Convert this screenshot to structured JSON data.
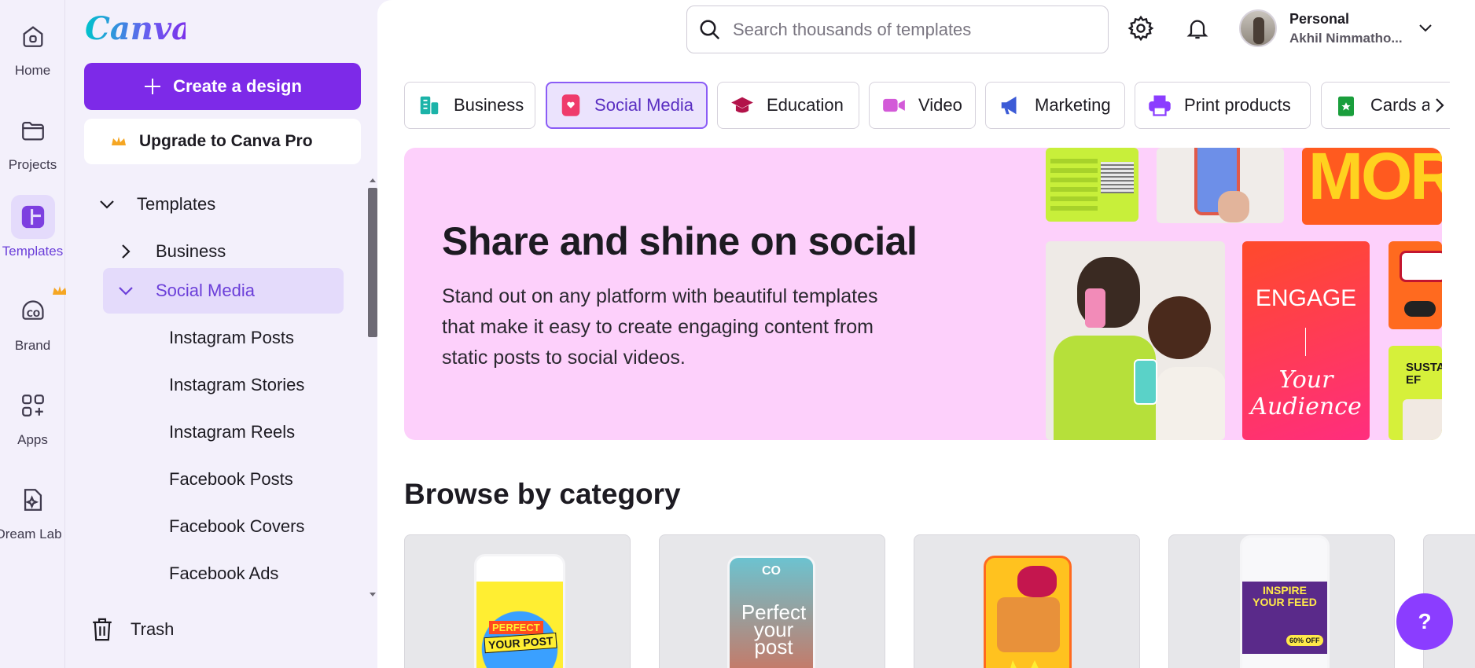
{
  "rail": {
    "items": [
      {
        "label": "Home",
        "icon": "home-icon"
      },
      {
        "label": "Projects",
        "icon": "folder-icon"
      },
      {
        "label": "Templates",
        "icon": "templates-icon"
      },
      {
        "label": "Brand",
        "icon": "brand-icon"
      },
      {
        "label": "Apps",
        "icon": "apps-icon"
      },
      {
        "label": "Dream Lab",
        "icon": "dream-lab-icon"
      }
    ]
  },
  "sidebar": {
    "logo": "Canva",
    "create_label": "Create a design",
    "upgrade_label": "Upgrade to Canva Pro",
    "tree": {
      "templates": "Templates",
      "business": "Business",
      "social_media": "Social Media",
      "children": [
        "Instagram Posts",
        "Instagram Stories",
        "Instagram Reels",
        "Facebook Posts",
        "Facebook Covers",
        "Facebook Ads"
      ]
    },
    "trash_label": "Trash"
  },
  "header": {
    "search_placeholder": "Search thousands of templates",
    "profile_name": "Personal",
    "profile_sub": "Akhil Nimmatho..."
  },
  "categories": [
    {
      "label": "Business",
      "icon": "business-icon",
      "color": "#1bb3a8"
    },
    {
      "label": "Social Media",
      "icon": "social-media-icon",
      "color": "#ef3b6b"
    },
    {
      "label": "Education",
      "icon": "education-icon",
      "color": "#b2134a"
    },
    {
      "label": "Video",
      "icon": "video-icon",
      "color": "#d35ad8"
    },
    {
      "label": "Marketing",
      "icon": "marketing-icon",
      "color": "#3c5bd6"
    },
    {
      "label": "Print products",
      "icon": "print-icon",
      "color": "#8b3dff"
    },
    {
      "label": "Cards an",
      "icon": "cards-icon",
      "color": "#1a9e3c"
    }
  ],
  "hero": {
    "title": "Share and shine on social",
    "text": "Stand out on any platform with beautiful templates that make it easy to create engaging content from static posts to  social videos.",
    "tiles": {
      "more": "MOR",
      "engage": "ENGAGE",
      "your_audience": "Your Audience",
      "susta": "SUSTA EF"
    }
  },
  "browse": {
    "title": "Browse by category",
    "cards": [
      {
        "line1": "PERFECT",
        "line2": "YOUR POST"
      },
      {
        "line1": "CO",
        "line2": "Perfect your post"
      },
      {
        "line1": "",
        "line2": ""
      },
      {
        "line1": "INSPIRE YOUR FEED",
        "line2": "60% OFF"
      }
    ]
  },
  "help_label": "?",
  "colors": {
    "accent": "#7d2ae8",
    "hero_bg": "#fdd0fb",
    "sidebar_bg": "#f3f0fb"
  }
}
